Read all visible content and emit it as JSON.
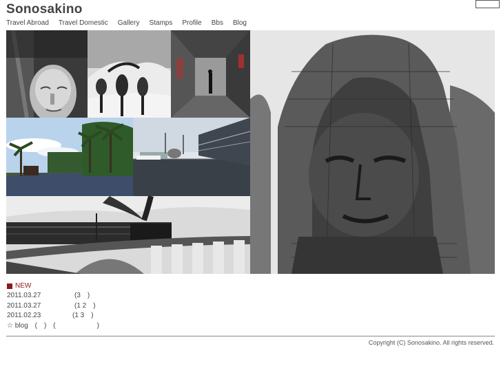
{
  "site": {
    "title": "Sonosakino"
  },
  "nav": {
    "items": [
      {
        "label": "Travel Abroad"
      },
      {
        "label": "Travel Domestic"
      },
      {
        "label": "Gallery"
      },
      {
        "label": "Stamps"
      },
      {
        "label": "Profile"
      },
      {
        "label": "Bbs"
      },
      {
        "label": "Blog"
      }
    ]
  },
  "gallery": {
    "photos": [
      {
        "subject": "stone-buddha-head"
      },
      {
        "subject": "desert-dunes-trees"
      },
      {
        "subject": "market-corridor"
      },
      {
        "subject": "tropical-palms-river"
      },
      {
        "subject": "harbor-city-skyline"
      },
      {
        "subject": "steam-train-viaduct"
      },
      {
        "subject": "bayon-stone-face"
      }
    ]
  },
  "news": {
    "heading": "NEW",
    "entries": [
      {
        "date": "2011.03.27",
        "title": "",
        "count": "(3　)"
      },
      {
        "date": "2011.03.27",
        "title": "",
        "count": "(1 2　)"
      },
      {
        "date": "2011.02.23",
        "title": "",
        "count": "(1 3　)"
      }
    ],
    "blog_line": "☆ blog　(　)　(　　　　　　)"
  },
  "footer": {
    "copyright": "Copyright (C) Sonosakino. All rights reserved."
  }
}
